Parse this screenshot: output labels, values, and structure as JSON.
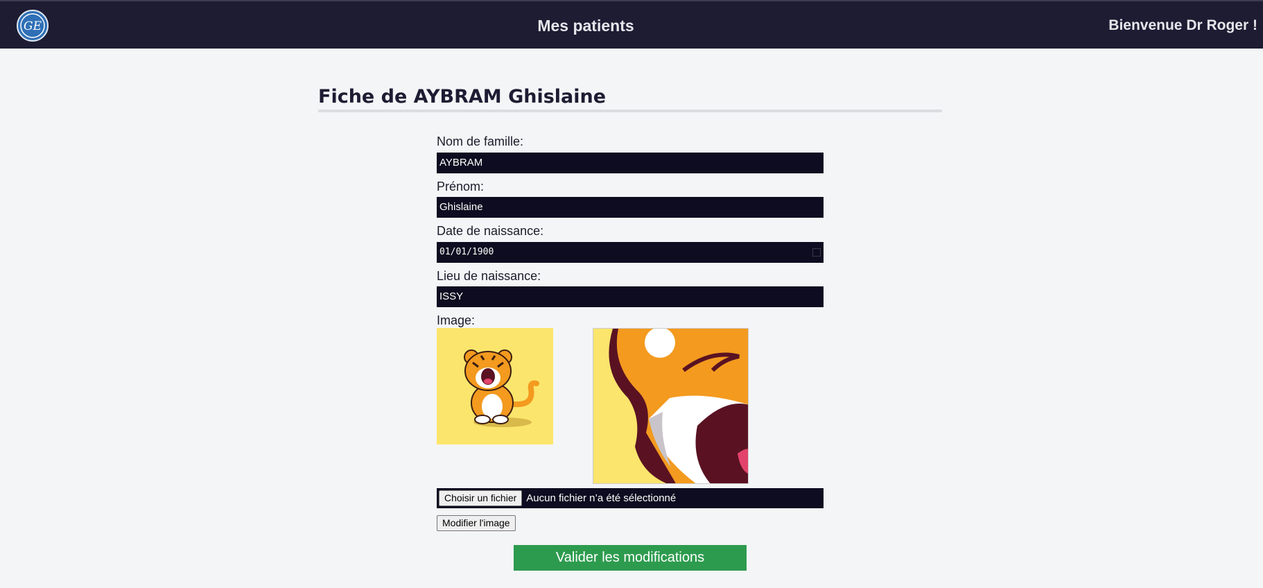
{
  "header": {
    "title": "Mes patients",
    "welcome": "Bienvenue Dr Roger !",
    "logo_icon": "ge-logo-icon",
    "logo_text": "GE"
  },
  "page": {
    "title": "Fiche de AYBRAM Ghislaine"
  },
  "form": {
    "last_name": {
      "label": "Nom de famille:",
      "value": "AYBRAM"
    },
    "first_name": {
      "label": "Prénom:",
      "value": "Ghislaine"
    },
    "birth_date": {
      "label": "Date de naissance:",
      "value": "01/01/1900"
    },
    "birth_place": {
      "label": "Lieu de naissance:",
      "value": "ISSY"
    },
    "image": {
      "label": "Image:",
      "file_button": "Choisir un fichier",
      "file_status": "Aucun fichier n’a été sélectionné",
      "modify_button": "Modifier l'image"
    },
    "submit_button": "Valider les modifications"
  },
  "colors": {
    "header_bg": "#1d1c33",
    "input_bg": "#0d0c20",
    "submit_bg": "#2d9b4e",
    "image_bg": "#fbe56c"
  }
}
